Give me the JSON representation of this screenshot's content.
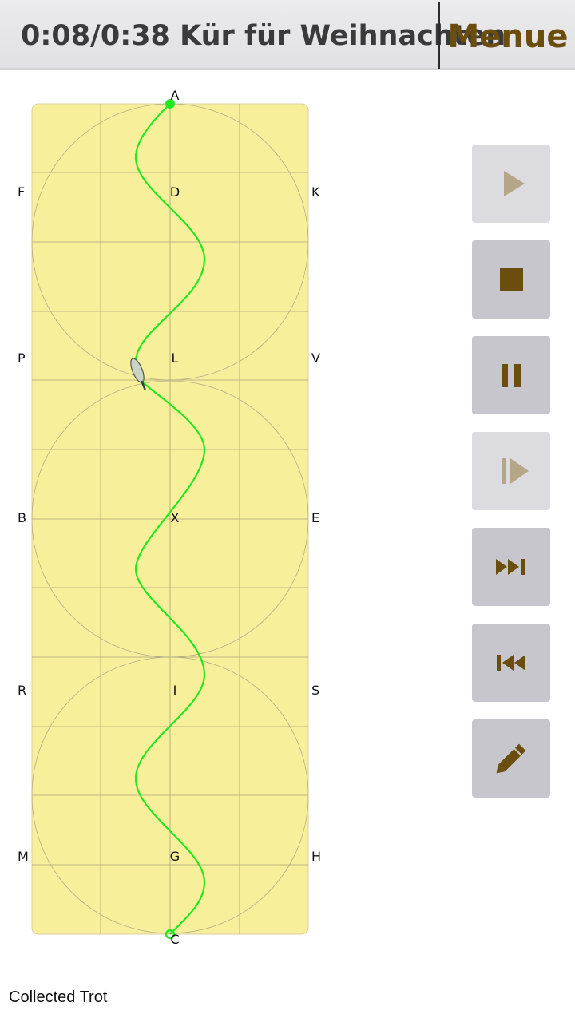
{
  "header": {
    "title": "0:08/0:38 Kür für Weihnachten",
    "menu_label": "Menue"
  },
  "arena": {
    "letters": {
      "top": "A",
      "bottom": "C",
      "left": [
        "F",
        "P",
        "B",
        "R",
        "M"
      ],
      "center": [
        "D",
        "L",
        "X",
        "I",
        "G"
      ],
      "right": [
        "K",
        "V",
        "E",
        "S",
        "H"
      ]
    },
    "colors": {
      "sand": "#f8ef9b",
      "path": "#22e822",
      "grid": "#a8a278"
    }
  },
  "playback": {
    "progress_seconds": 8,
    "total_seconds": 38
  },
  "controls": [
    {
      "name": "play-button",
      "icon": "play-icon",
      "enabled": false
    },
    {
      "name": "stop-button",
      "icon": "stop-icon",
      "enabled": true
    },
    {
      "name": "pause-button",
      "icon": "pause-icon",
      "enabled": true
    },
    {
      "name": "step-forward-button",
      "icon": "step-forward-icon",
      "enabled": false
    },
    {
      "name": "skip-forward-button",
      "icon": "skip-forward-icon",
      "enabled": true
    },
    {
      "name": "skip-back-button",
      "icon": "skip-back-icon",
      "enabled": true
    },
    {
      "name": "edit-button",
      "icon": "pencil-icon",
      "enabled": true
    }
  ],
  "status": {
    "gait": "Collected Trot"
  }
}
